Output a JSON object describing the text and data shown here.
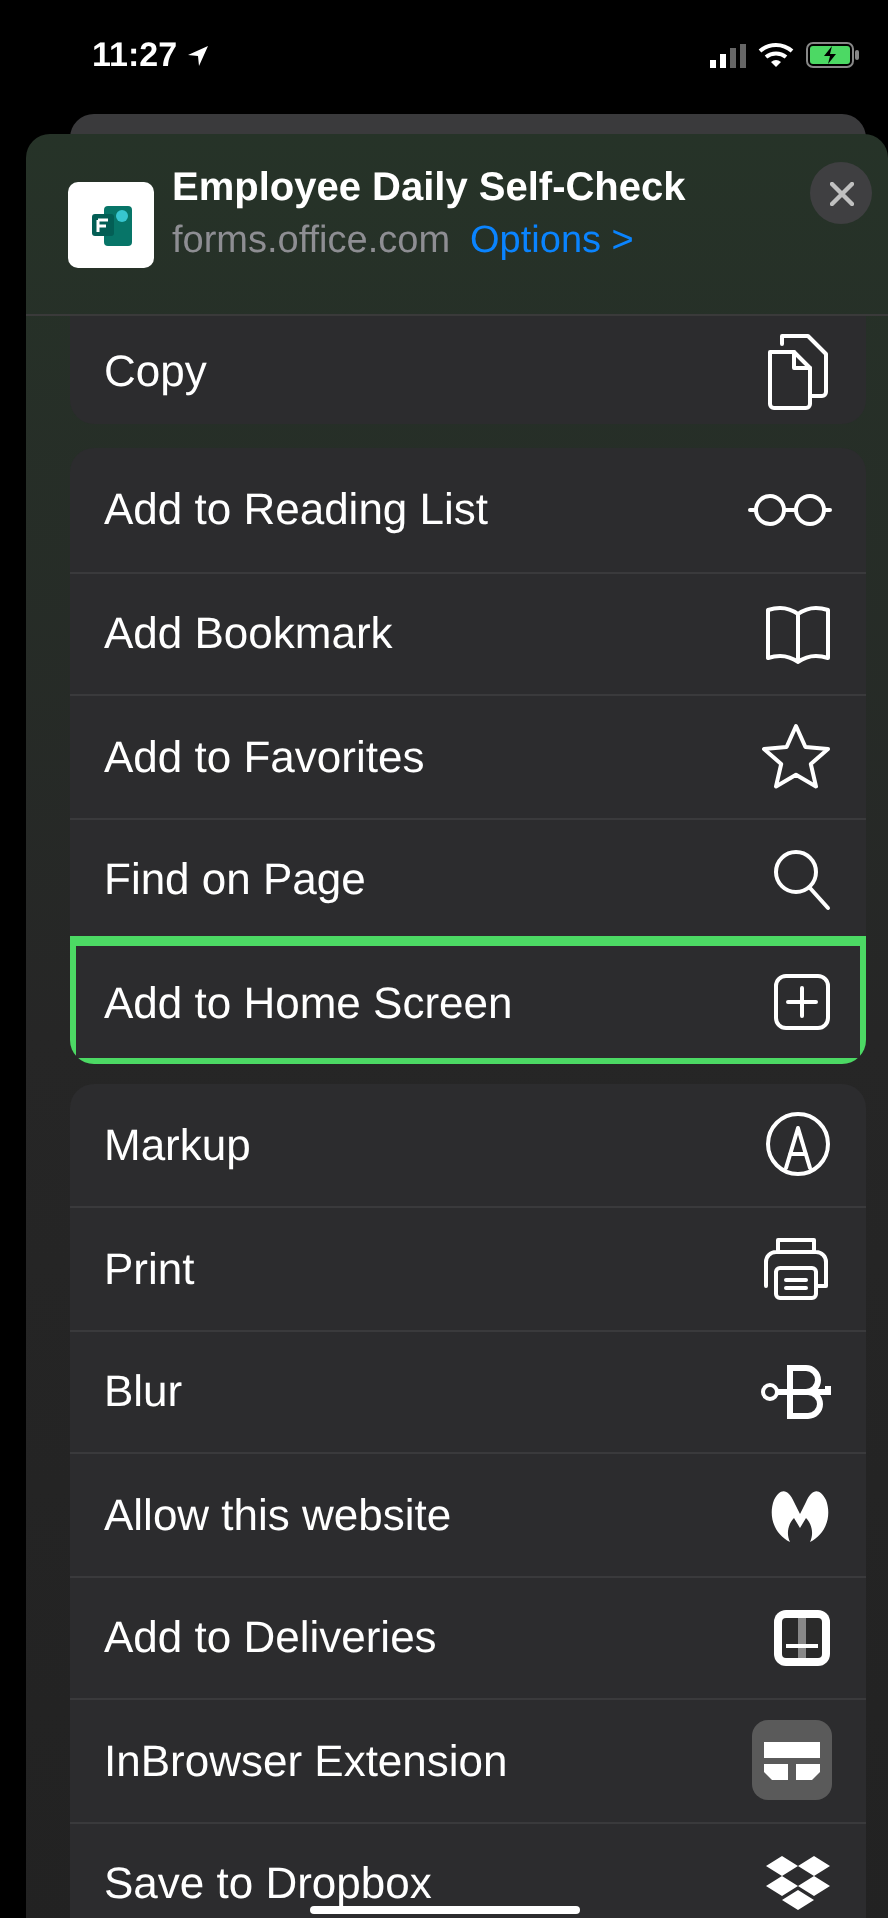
{
  "status_bar": {
    "time": "11:27"
  },
  "share_header": {
    "title": "Employee Daily Self-Check",
    "domain": "forms.office.com",
    "options_link": "Options >"
  },
  "action_groups": [
    {
      "items": [
        {
          "label": "Copy",
          "highlighted": false
        }
      ]
    },
    {
      "items": [
        {
          "label": "Add to Reading List",
          "highlighted": false
        },
        {
          "label": "Add Bookmark",
          "highlighted": false
        },
        {
          "label": "Add to Favorites",
          "highlighted": false
        },
        {
          "label": "Find on Page",
          "highlighted": false
        },
        {
          "label": "Add to Home Screen",
          "highlighted": true
        }
      ]
    },
    {
      "items": [
        {
          "label": "Markup",
          "highlighted": false
        },
        {
          "label": "Print",
          "highlighted": false
        },
        {
          "label": "Blur",
          "highlighted": false
        },
        {
          "label": "Allow this website",
          "highlighted": false
        },
        {
          "label": "Add to Deliveries",
          "highlighted": false
        },
        {
          "label": "InBrowser Extension",
          "highlighted": false
        },
        {
          "label": "Save to Dropbox",
          "highlighted": false
        }
      ]
    }
  ]
}
